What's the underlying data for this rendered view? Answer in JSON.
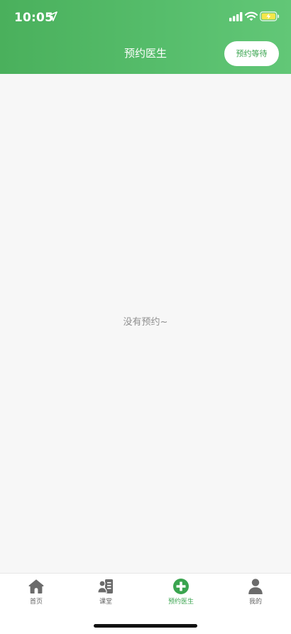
{
  "status_bar": {
    "time": "10:05"
  },
  "header": {
    "title": "预约医生",
    "action_button_label": "预约等待"
  },
  "content": {
    "empty_message": "没有预约~"
  },
  "tab_bar": {
    "active_index": 2,
    "active_color": "#3aa44f",
    "inactive_color": "#666666",
    "items": [
      {
        "label": "首页",
        "icon": "home-icon"
      },
      {
        "label": "课堂",
        "icon": "classroom-icon"
      },
      {
        "label": "预约医生",
        "icon": "add-circle-icon"
      },
      {
        "label": "我的",
        "icon": "user-icon"
      }
    ]
  },
  "theme": {
    "header_color": "#4ab05c",
    "background": "#f7f7f7"
  }
}
